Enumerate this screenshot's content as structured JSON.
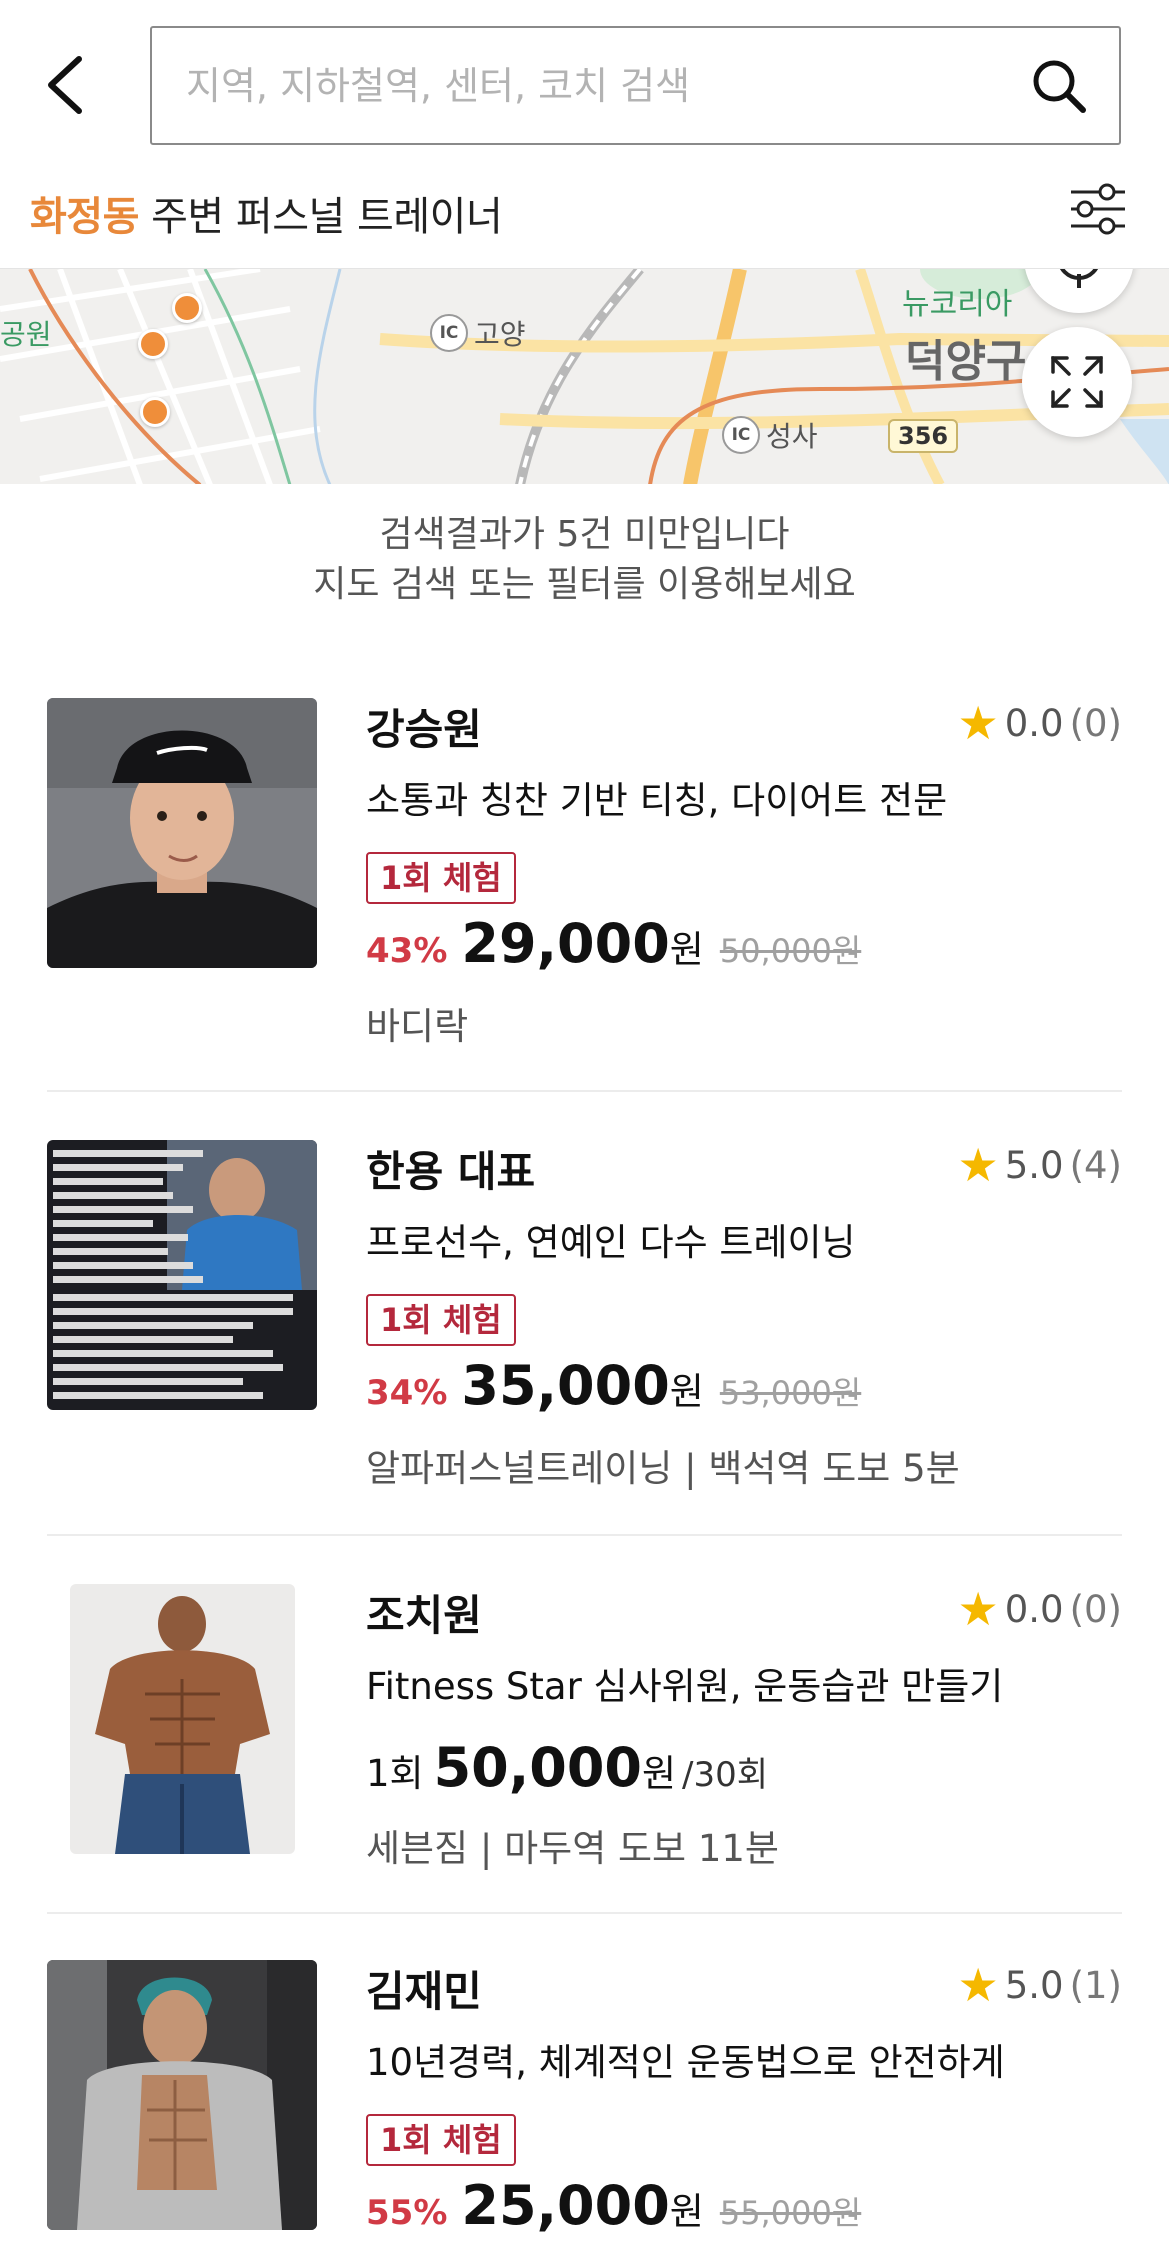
{
  "header": {
    "back_icon": "chevron-left-icon",
    "search_placeholder": "지역, 지하철역, 센터, 코치 검색",
    "search_icon": "search-icon"
  },
  "location_bar": {
    "area": "화정동",
    "suffix": " 주변 퍼스널 트레이너",
    "area_color": "#e8883a",
    "filter_icon": "sliders-icon"
  },
  "map": {
    "labels": {
      "ic1": "고양",
      "ic2": "성사",
      "route": "356",
      "district": "덕양구",
      "left_edge": "공원",
      "top_right": "뉴코리아",
      "ic_text": "IC"
    },
    "pin_color": "#ef8e3a",
    "controls": [
      "locate-icon",
      "expand-icon"
    ]
  },
  "notice": {
    "line1": "검색결과가 5건 미만입니다",
    "line2": "지도 검색 또는 필터를 이용해보세요"
  },
  "trainers": [
    {
      "name": "강승원",
      "rating": "0.0",
      "review_count": "(0)",
      "description": "소통과 칭찬 기반 티칭, 다이어트 전문",
      "badge": "1회 체험",
      "discount": "43%",
      "price": "29,000",
      "won": "원",
      "original_price": "50,000원",
      "location": "바디락"
    },
    {
      "name": "한용 대표",
      "rating": "5.0",
      "review_count": "(4)",
      "description": "프로선수, 연예인 다수 트레이닝",
      "badge": "1회 체험",
      "discount": "34%",
      "price": "35,000",
      "won": "원",
      "original_price": "53,000원",
      "location": "알파퍼스널트레이닝 | 백석역 도보 5분"
    },
    {
      "name": "조치원",
      "rating": "0.0",
      "review_count": "(0)",
      "description": "Fitness Star 심사위원, 운동습관 만들기",
      "unit_prefix": "1회",
      "price": "50,000",
      "won": "원",
      "per_unit": "/30회",
      "location": "세븐짐 | 마두역 도보 11분"
    },
    {
      "name": "김재민",
      "rating": "5.0",
      "review_count": "(1)",
      "description": "10년경력, 체계적인 운동법으로 안전하게",
      "badge": "1회 체험",
      "discount": "55%",
      "price": "25,000",
      "won": "원",
      "original_price": "55,000원"
    }
  ],
  "colors": {
    "accent_orange": "#e8883a",
    "trial_red": "#b4283c",
    "discount_red": "#d13a45",
    "star_yellow": "#f5b800"
  }
}
